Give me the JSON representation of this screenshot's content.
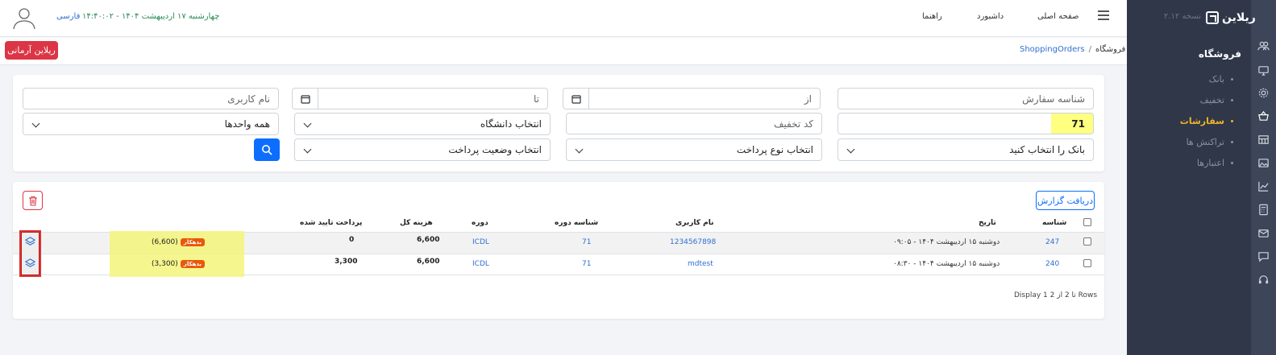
{
  "sidebar": {
    "brand": "ریلاین",
    "version": "نسخه ۲.۱۲",
    "section_title": "فروشگاه",
    "items": [
      {
        "label": "بانک",
        "active": false
      },
      {
        "label": "تخفیف",
        "active": false
      },
      {
        "label": "سفارشات",
        "active": true
      },
      {
        "label": "تراکنش ها",
        "active": false
      },
      {
        "label": "اعتبارها",
        "active": false
      }
    ],
    "rail_icons": [
      "users-icon",
      "monitor-icon",
      "gear-icon",
      "basket-icon",
      "store-icon",
      "image-icon",
      "chart-icon",
      "calculator-icon",
      "mail-icon",
      "chat-icon",
      "headset-icon"
    ]
  },
  "header": {
    "nav": [
      "صفحه اصلی",
      "داشبورد",
      "راهنما"
    ],
    "datetime": "چهارشنبه ۱۷ اردیبهشت ۱۴۰۴ - ۱۴:۴۰:۰۲",
    "language": "فارسی"
  },
  "breadcrumb": {
    "root": "فروشگاه",
    "separator": "/",
    "current": "ShoppingOrders"
  },
  "top_button": "ریلاین آرمانی",
  "filters": {
    "order_id": {
      "placeholder": "شناسه سفارش"
    },
    "from_date": {
      "placeholder": "از"
    },
    "to_date": {
      "placeholder": "تا"
    },
    "username": {
      "placeholder": "نام کاربری"
    },
    "order_value": "71",
    "discount_code": {
      "placeholder": "کد تخفیف"
    },
    "university": "انتخاب دانشگاه",
    "units": "همه واحدها",
    "bank": "بانک را انتخاب کنید",
    "payment_type": "انتخاب نوع پرداخت",
    "payment_status": "انتخاب وضعیت پرداخت"
  },
  "report_button": "دریافت گزارش",
  "table": {
    "headers": {
      "id": "شناسه",
      "date": "تاریخ",
      "username": "نام کاربری",
      "course_id": "شناسه دوره",
      "course": "دوره",
      "total_cost": "هزینه کل",
      "approved_payment": "پرداخت تایید شده"
    },
    "rows": [
      {
        "id": "247",
        "date": "دوشنبه ۱۵ اردیبهشت ۱۴۰۴ - ۰۹:۰۵",
        "username": "1234567898",
        "course_id": "71",
        "course": "ICDL",
        "total_cost": "6,600",
        "approved_payment": "0",
        "status_badge": "بدهکار",
        "debt": "(6,600)"
      },
      {
        "id": "240",
        "date": "دوشنبه ۱۵ اردیبهشت ۱۴۰۴ - ۰۸:۳۰",
        "username": "mdtest",
        "course_id": "71",
        "course": "ICDL",
        "total_cost": "6,600",
        "approved_payment": "3,300",
        "status_badge": "بدهکار",
        "debt": "(3,300)"
      }
    ],
    "footer": "Display 1 تا 2 از 2 Rows"
  },
  "colors": {
    "sidebar_bg": "#2f3749",
    "rail_bg": "#3d4658",
    "active": "#f0b429",
    "primary": "#0d6efd",
    "danger": "#dc3545",
    "highlight": "#ffff80"
  }
}
